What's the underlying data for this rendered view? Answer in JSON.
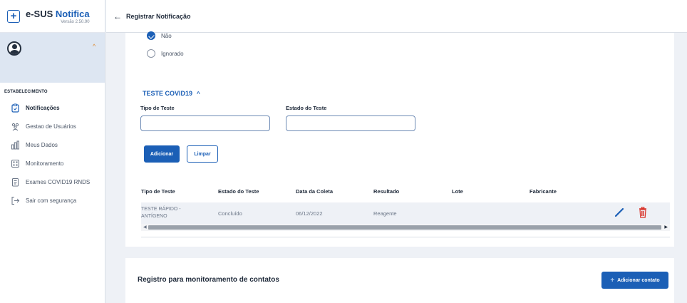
{
  "app": {
    "name_prefix": "e-SUS",
    "name_accent": "Notifica",
    "version": "Versão 2.50.90"
  },
  "sidebar": {
    "section_label": "ESTABELECIMENTO",
    "items": [
      {
        "label": "Notificações",
        "icon": "clipboard-icon",
        "active": true
      },
      {
        "label": "Gestao de Usuários",
        "icon": "users-icon",
        "active": false
      },
      {
        "label": "Meus Dados",
        "icon": "bar-chart-icon",
        "active": false
      },
      {
        "label": "Monitoramento",
        "icon": "monitor-icon",
        "active": false
      },
      {
        "label": "Exames COVID19 RNDS",
        "icon": "document-icon",
        "active": false
      },
      {
        "label": "Sair com segurança",
        "icon": "exit-icon",
        "active": false
      }
    ]
  },
  "header": {
    "back_icon": "arrow-left-icon",
    "title": "Registrar Notificação"
  },
  "form": {
    "radio_options": [
      {
        "label": "Não",
        "checked": true
      },
      {
        "label": "Ignorado",
        "checked": false
      }
    ],
    "section_title": "TESTE COVID19",
    "fields": {
      "test_type_label": "Tipo de Teste",
      "test_state_label": "Estado do Teste"
    },
    "buttons": {
      "add": "Adicionar",
      "clear": "Limpar"
    }
  },
  "table": {
    "headers": [
      "Tipo de Teste",
      "Estado do Teste",
      "Data da Coleta",
      "Resultado",
      "Lote",
      "Fabricante"
    ],
    "rows": [
      {
        "type_line1": "TESTE RÁPIDO -",
        "type_line2": "ANTÍGENO",
        "state": "Concluído",
        "date": "06/12/2022",
        "result": "Reagente",
        "lot": "",
        "manufacturer": ""
      }
    ]
  },
  "contacts": {
    "title": "Registro para monitoramento de contatos",
    "add_button": "Adicionar contato"
  },
  "colors": {
    "primary": "#1b5fb6",
    "danger": "#d9342b",
    "sidebar_user_bg": "#dde6f2"
  }
}
